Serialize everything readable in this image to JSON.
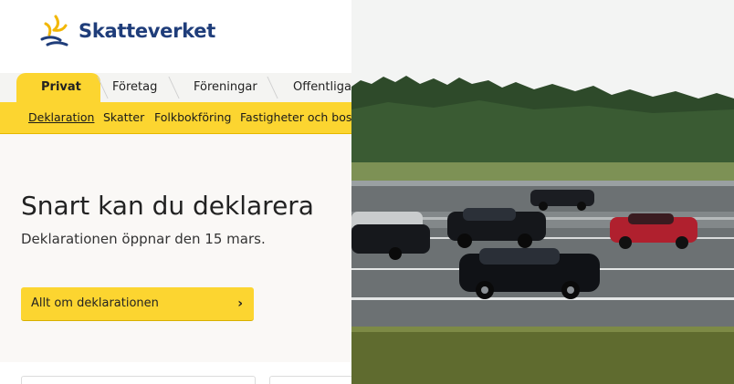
{
  "brand": {
    "name": "Skatteverket",
    "colors": {
      "yellow": "#fcd530",
      "navy": "#1f3d7a"
    }
  },
  "tabs": [
    {
      "label": "Privat",
      "active": true
    },
    {
      "label": "Företag",
      "active": false
    },
    {
      "label": "Föreningar",
      "active": false
    },
    {
      "label": "Offentliga",
      "active": false
    }
  ],
  "subnav": [
    {
      "label": "Deklaration",
      "active": true
    },
    {
      "label": "Skatter",
      "active": false
    },
    {
      "label": "Folkbokföring",
      "active": false
    },
    {
      "label": "Fastigheter och bos",
      "active": false
    }
  ],
  "hero": {
    "title": "Snart kan du deklarera",
    "subtitle": "Deklarationen öppnar den 15 mars.",
    "cta_label": "Allt om deklarationen",
    "cta_icon": "chevron-right-icon"
  }
}
